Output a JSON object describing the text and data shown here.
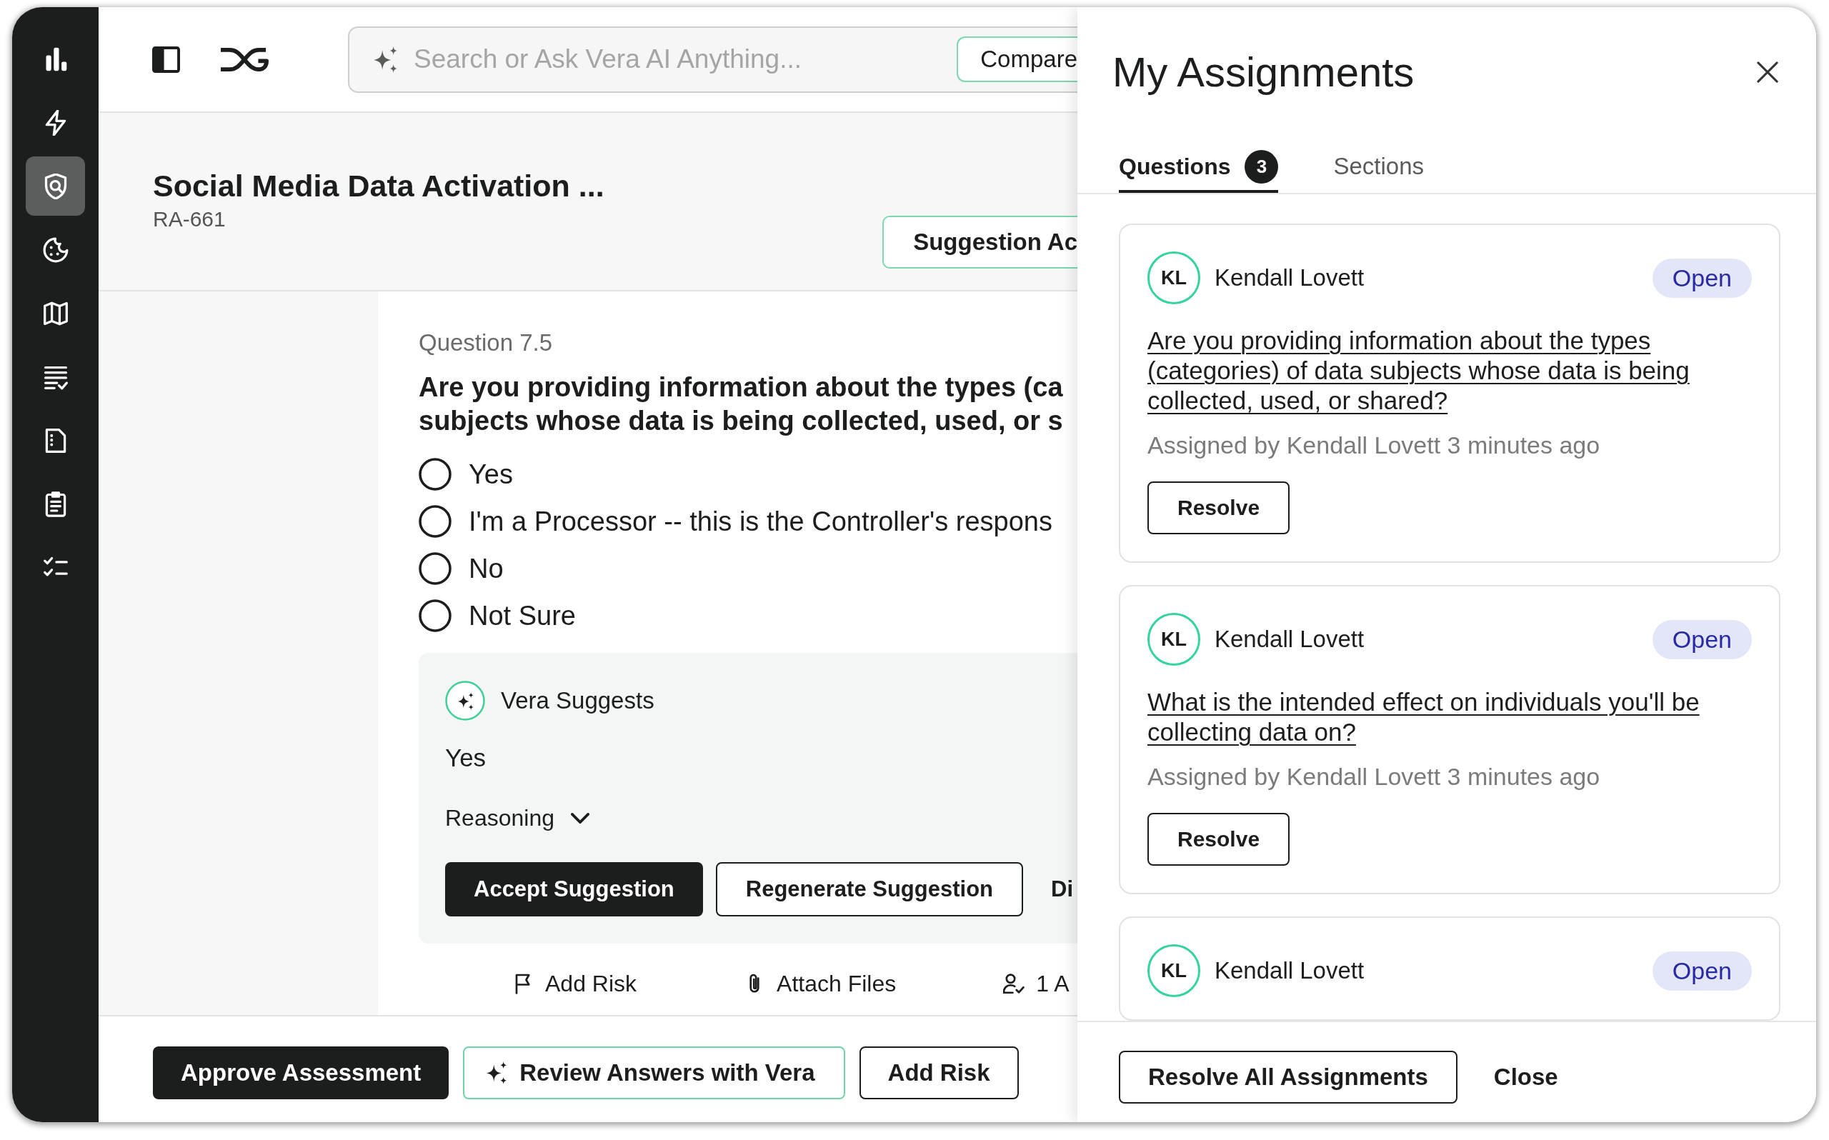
{
  "sidebar": {
    "items": [
      {
        "kind": "chart",
        "selected": false
      },
      {
        "kind": "bolt",
        "selected": false
      },
      {
        "kind": "shield",
        "selected": true
      },
      {
        "kind": "cookie",
        "selected": false
      },
      {
        "kind": "map",
        "selected": false
      },
      {
        "kind": "list",
        "selected": false
      },
      {
        "kind": "document",
        "selected": false
      },
      {
        "kind": "clipboard",
        "selected": false
      },
      {
        "kind": "checklist",
        "selected": false
      }
    ]
  },
  "top_bar": {
    "search": {
      "placeholder": "Search or Ask Vera AI Anything..."
    },
    "compare_button": "Compare"
  },
  "header": {
    "title": "Social Media Data Activation ...",
    "reference": "RA-661",
    "suggestion_button": "Suggestion Ac"
  },
  "question": {
    "number": "Question 7.5",
    "text_lines": [
      "Are you providing information about the types (ca",
      "subjects whose data is being collected, used, or s"
    ],
    "options": [
      {
        "label": "Yes",
        "selected": false
      },
      {
        "label": "I'm a Processor -- this is the Controller's respons",
        "selected": false
      },
      {
        "label": "No",
        "selected": false
      },
      {
        "label": "Not Sure",
        "selected": false
      }
    ]
  },
  "suggestion": {
    "title": "Vera Suggests",
    "answer": "Yes",
    "reasoning": {
      "label": "Reasoning",
      "expanded": false
    },
    "buttons": [
      {
        "label": "Accept Suggestion",
        "kind": "primary"
      },
      {
        "label": "Regenerate Suggestion",
        "kind": "secondary"
      },
      {
        "label": "Di",
        "kind": "text"
      }
    ]
  },
  "actions": [
    {
      "label": "Add Risk",
      "kind": "flag"
    },
    {
      "label": "Attach Files",
      "kind": "attach"
    },
    {
      "label": "1 A",
      "kind": "assignee"
    }
  ],
  "footer": {
    "buttons": [
      {
        "label": "Approve Assessment",
        "kind": "primary"
      },
      {
        "label": "Review Answers with Vera",
        "kind": "ai"
      },
      {
        "label": "Add Risk",
        "kind": "secondary"
      }
    ]
  },
  "panel": {
    "title": "My Assignments",
    "tabs": [
      {
        "label": "Questions",
        "count": "3",
        "selected": true
      },
      {
        "label": "Sections",
        "selected": false
      }
    ],
    "assignments": [
      {
        "initials": "KL",
        "name": "Kendall Lovett",
        "status": "Open",
        "question": "Are you providing information about the types (categories) of data subjects whose data is being collected, used, or shared?",
        "assigned": "Assigned by Kendall Lovett 3 minutes ago",
        "button": "Resolve"
      },
      {
        "initials": "KL",
        "name": "Kendall Lovett",
        "status": "Open",
        "question": "What is the intended effect on individuals you'll be collecting data on?",
        "assigned": "Assigned by Kendall Lovett 3 minutes ago",
        "button": "Resolve"
      },
      {
        "initials": "KL",
        "name": "Kendall Lovett",
        "status": "Open"
      }
    ],
    "footer": {
      "resolve_all_button": "Resolve All Assignments",
      "close_button": "Close"
    }
  }
}
